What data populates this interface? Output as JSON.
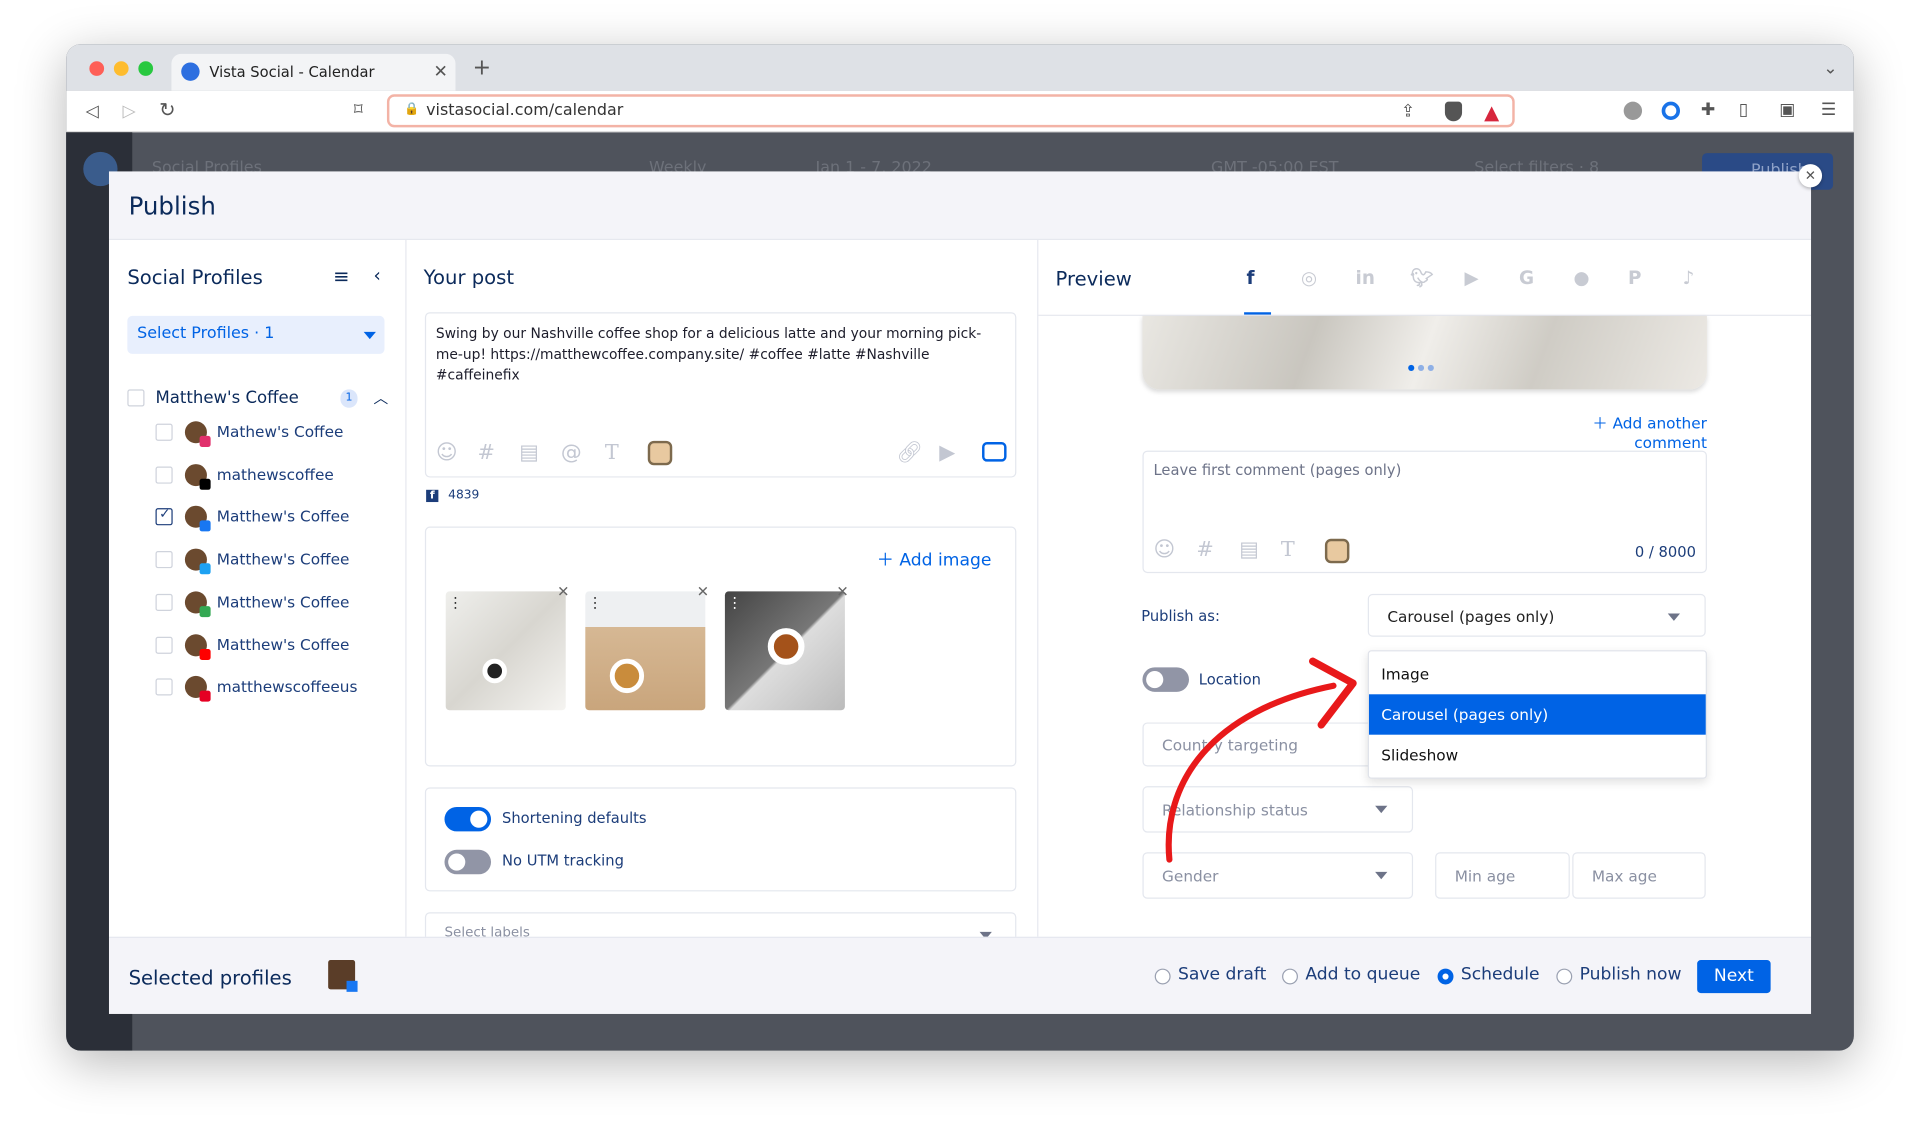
{
  "browser": {
    "tab_title": "Vista Social - Calendar",
    "url": "vistasocial.com/calendar"
  },
  "background": {
    "social_profiles": "Social Profiles",
    "view": "Weekly",
    "date_range": "Jan 1 - 7, 2022",
    "timezone": "GMT -05:00 EST",
    "filters": "Select filters · 8",
    "publish_btn": "Publish"
  },
  "modal": {
    "title": "Publish"
  },
  "profiles": {
    "title": "Social Profiles",
    "select_label": "Select Profiles · 1",
    "group": {
      "name": "Matthew's Coffee",
      "count": "1"
    },
    "items": [
      {
        "name": "Mathew's Coffee",
        "network": "instagram",
        "checked": false,
        "badge": "#e1306c"
      },
      {
        "name": "mathewscoffee",
        "network": "tiktok",
        "checked": false,
        "badge": "#000000"
      },
      {
        "name": "Matthew's Coffee",
        "network": "facebook",
        "checked": true,
        "badge": "#1877f2"
      },
      {
        "name": "Matthew's Coffee",
        "network": "twitter",
        "checked": false,
        "badge": "#1da1f2"
      },
      {
        "name": "Matthew's Coffee",
        "network": "google",
        "checked": false,
        "badge": "#34a853"
      },
      {
        "name": "Matthew's Coffee",
        "network": "youtube",
        "checked": false,
        "badge": "#ff0000"
      },
      {
        "name": "matthewscoffeeus",
        "network": "pinterest",
        "checked": false,
        "badge": "#e60023"
      }
    ]
  },
  "post": {
    "title": "Your post",
    "text": "Swing by our Nashville coffee shop for a delicious latte and your morning pick-me-up! https://matthewcoffee.company.site/ #coffee #latte #Nashville #caffeinefix",
    "char_count": "4839",
    "add_image": "Add image",
    "shortening": "Shortening defaults",
    "shortening_on": true,
    "utm": "No UTM tracking",
    "utm_on": false,
    "labels_placeholder": "Select labels"
  },
  "preview": {
    "title": "Preview",
    "networks": [
      "facebook",
      "instagram",
      "linkedin",
      "twitter",
      "youtube",
      "google",
      "reddit",
      "pinterest",
      "tiktok"
    ],
    "active_network": "facebook",
    "add_comment": "Add another comment",
    "comment_placeholder": "Leave first comment (pages only)",
    "comment_count": "0 / 8000",
    "publish_as_label": "Publish as:",
    "publish_as_value": "Carousel (pages only)",
    "options": [
      "Image",
      "Carousel (pages only)",
      "Slideshow"
    ],
    "selected_option": "Carousel (pages only)",
    "location": "Location",
    "country_placeholder": "Country targeting",
    "relationship_placeholder": "Relationship status",
    "gender_placeholder": "Gender",
    "min_age": "Min age",
    "max_age": "Max age"
  },
  "footer": {
    "selected_profiles": "Selected profiles",
    "options": [
      "Save draft",
      "Add to queue",
      "Schedule",
      "Publish now"
    ],
    "selected": "Schedule",
    "next": "Next"
  },
  "colors": {
    "accent": "#0063e5",
    "navy": "#0b2a5b",
    "annotation_arrow": "#e8191a"
  }
}
